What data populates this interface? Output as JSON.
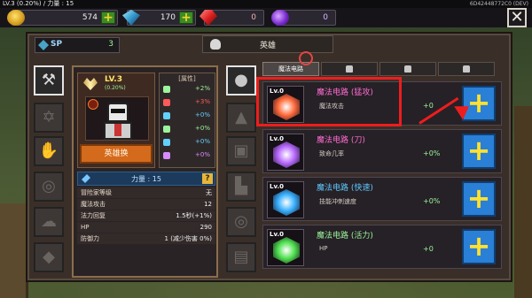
{
  "status": {
    "text": "LV.3 (0.20%) / 力量 : 15",
    "device_id": "6D42448772C0 (DEV)"
  },
  "currency": {
    "gold": "574",
    "gems": "170",
    "ruby": "0",
    "orb": "0"
  },
  "window": {
    "sp_label": "SP",
    "sp_value": "3",
    "title": "英雄"
  },
  "hero": {
    "level": "LV.3",
    "level_pct": "(0.20%)",
    "change_label": "英雄换",
    "attr_title": "[属性]",
    "attrs": [
      {
        "value": "+2%",
        "color": "#9cf59c",
        "icon": "sword-icon"
      },
      {
        "value": "+3%",
        "color": "#ff5a5a",
        "icon": "fire-icon"
      },
      {
        "value": "+0%",
        "color": "#62d0ff",
        "icon": "drop-icon"
      },
      {
        "value": "+0%",
        "color": "#9cf59c",
        "icon": "leaf-icon"
      },
      {
        "value": "+0%",
        "color": "#62d0ff",
        "icon": "wind-icon"
      },
      {
        "value": "+0%",
        "color": "#d68cff",
        "icon": "dark-icon"
      }
    ],
    "power_label": "力量 : 15",
    "question_label": "?",
    "stats": [
      {
        "label": "冒险家等级",
        "value": "无"
      },
      {
        "label": "魔法攻击",
        "value": "12"
      },
      {
        "label": "法力回复",
        "value": "1.5秒(+1%)"
      },
      {
        "label": "HP",
        "value": "290"
      },
      {
        "label": "防御力",
        "value": "1 (减少伤害 0%)"
      }
    ]
  },
  "tabs": [
    {
      "label": "魔法电路",
      "locked": false
    },
    {
      "label": "",
      "locked": true
    },
    {
      "label": "",
      "locked": true
    },
    {
      "label": "",
      "locked": true
    }
  ],
  "skills": [
    {
      "level": "Lv.0",
      "name": "魔法电路 (猛攻)",
      "desc": "魔法攻击",
      "value": "+0",
      "name_color": "#ff6bd2",
      "gem_color": "#ff6a3a"
    },
    {
      "level": "Lv.0",
      "name": "魔法电路 (刀)",
      "desc": "致命几率",
      "value": "+0%",
      "name_color": "#ff6bd2",
      "gem_color": "#b86aff"
    },
    {
      "level": "Lv.0",
      "name": "魔法电路 (快速)",
      "desc": "技能冲刺速度",
      "value": "+0%",
      "name_color": "#5ec8ff",
      "gem_color": "#38b0ff"
    },
    {
      "level": "Lv.0",
      "name": "魔法电路 (活力)",
      "desc": "HP",
      "value": "+0",
      "name_color": "#9cf59c",
      "gem_color": "#4ee04e"
    }
  ],
  "plus_label": "+",
  "close_label": "✕"
}
